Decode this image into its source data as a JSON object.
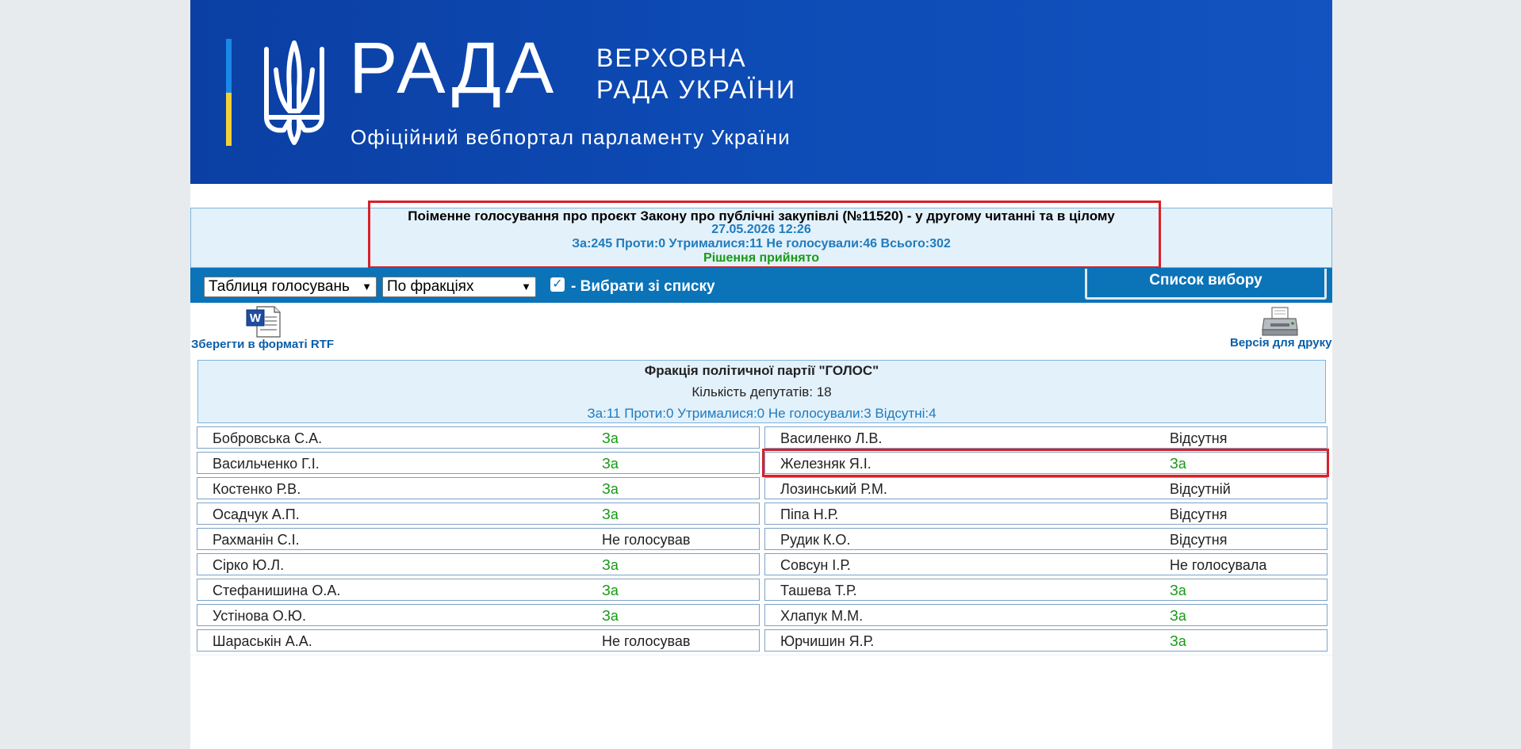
{
  "header": {
    "logo_word": "РАДА",
    "logo_line1": "ВЕРХОВНА",
    "logo_line2": "РАДА УКРАЇНИ",
    "tagline": "Офіційний вебпортал парламенту України"
  },
  "vote": {
    "title": "Поіменне голосування про проєкт Закону про публічні закупівлі (№11520) - у другому читанні та в цілому",
    "datetime": "27.05.2026 12:26",
    "totals": "За:245 Проти:0 Утрималися:11 Не голосували:46 Всього:302",
    "decision": "Рішення прийнято"
  },
  "controls": {
    "view_select": "Таблиця голосувань",
    "group_select": "По фракціях",
    "select_from_list_checked": true,
    "select_from_list_label": "- Вибрати зі списку",
    "list_button": "Список вибору"
  },
  "export": {
    "rtf_label": "Зберегти в форматі RTF",
    "print_label": "Версія для друку"
  },
  "faction": {
    "name": "Фракція політичної партії \"ГОЛОС\"",
    "count": "Кількість депутатів: 18",
    "totals": "За:11 Проти:0 Утрималися:0 Не голосували:3 Відсутні:4"
  },
  "deputies_left": [
    {
      "name": "Бобровська С.А.",
      "vote": "За"
    },
    {
      "name": "Васильченко Г.І.",
      "vote": "За"
    },
    {
      "name": "Костенко Р.В.",
      "vote": "За"
    },
    {
      "name": "Осадчук А.П.",
      "vote": "За"
    },
    {
      "name": "Рахманін С.І.",
      "vote": "Не голосував"
    },
    {
      "name": "Сірко Ю.Л.",
      "vote": "За"
    },
    {
      "name": "Стефанишина О.А.",
      "vote": "За"
    },
    {
      "name": "Устінова О.Ю.",
      "vote": "За"
    },
    {
      "name": "Шараськін А.А.",
      "vote": "Не голосував"
    }
  ],
  "deputies_right": [
    {
      "name": "Василенко Л.В.",
      "vote": "Відсутня"
    },
    {
      "name": "Железняк Я.І.",
      "vote": "За"
    },
    {
      "name": "Лозинський Р.М.",
      "vote": "Відсутній"
    },
    {
      "name": "Піпа Н.Р.",
      "vote": "Відсутня"
    },
    {
      "name": "Рудик К.О.",
      "vote": "Відсутня"
    },
    {
      "name": "Совсун І.Р.",
      "vote": "Не голосувала"
    },
    {
      "name": "Ташева Т.Р.",
      "vote": "За"
    },
    {
      "name": "Хлапук М.М.",
      "vote": "За"
    },
    {
      "name": "Юрчишин Я.Р.",
      "vote": "За"
    }
  ],
  "colors": {
    "banner": "#0d4bb5",
    "control_bar": "#0b73b8",
    "vote_yes": "#169a14",
    "highlight": "#d8202a"
  }
}
